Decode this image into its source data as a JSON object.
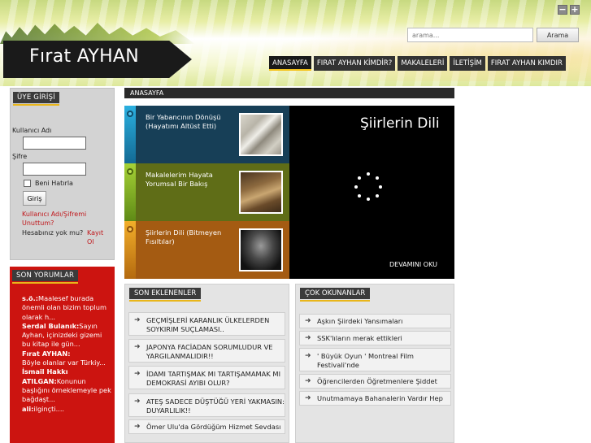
{
  "window_controls": {
    "minimize": "−",
    "maximize": "+"
  },
  "search": {
    "placeholder": "arama...",
    "button": "Arama"
  },
  "logo": {
    "text": "Fırat AYHAN"
  },
  "nav": [
    {
      "label": "ANASAYFA"
    },
    {
      "label": "FIRAT AYHAN KİMDİR?"
    },
    {
      "label": "MAKALELERİ"
    },
    {
      "label": "İLETİŞİM"
    },
    {
      "label": "FIRAT AYHAN KIMDIR"
    }
  ],
  "login": {
    "title": "ÜYE GİRİŞİ",
    "username_label": "Kullanıcı Adı",
    "password_label": "Şifre",
    "remember": "Beni Hatırla",
    "submit": "Giriş",
    "forgot": "Kullanıcı Adı/Şifremi Unuttum?",
    "no_account": "Hesabınız yok mu?",
    "register": "Kayıt Ol"
  },
  "comments": {
    "title": "SON YORUMLAR",
    "items": [
      {
        "author": "s.ö.:",
        "text": "Maalesef burada önemli olan bizim toplum olarak h..."
      },
      {
        "author": "Serdal Bulanık:",
        "text": "Sayın Ayhan, içinizdeki gizemi bu kitap ile gün..."
      },
      {
        "author": "Fırat AYHAN:",
        "text": "Böyle olanlar var Türkiy..."
      },
      {
        "author": "İsmail Hakkı ATILGAN:",
        "text": "Konunun başlığını örneklemeyle pek bağdaşt..."
      },
      {
        "author": "ali:",
        "text": "ilginçti...."
      }
    ]
  },
  "breadcrumb": "ANASAYFA",
  "featured": {
    "items": [
      {
        "title": "Bir Yabancının Dönüşü (Hayatımı Altüst Etti)",
        "color": "#173f57",
        "strip": "#1d93c4"
      },
      {
        "title": "Makalelerim Hayata Yorumsal Bir Bakış",
        "color": "#5f6d17",
        "strip": "#8ebf2a"
      },
      {
        "title": "Şiirlerin Dili (Bitmeyen Fısıltılar)",
        "color": "#a45b12",
        "strip": "#e79a1d"
      }
    ],
    "headline": "Şiirlerin Dili",
    "more": "DEVAMINI OKU"
  },
  "recent": {
    "title": "SON EKLENENLER",
    "items": [
      "GEÇMİŞLERİ KARANLIK ÜLKELERDEN SOYKIRIM SUÇLAMASI..",
      "JAPONYA FACİADAN SORUMLUDUR VE YARGILANMALIDIR!!",
      "İDAMI TARTIŞMAK MI TARTIŞAMAMAK MI DEMOKRASİ AYIBI OLUR?",
      "ATEŞ SADECE DÜŞTÜĞÜ YERİ YAKMASIN: DUYARLILIK!!",
      "Ömer Ulu'da Gördüğüm Hizmet Sevdası"
    ]
  },
  "popular": {
    "title": "ÇOK OKUNANLAR",
    "items": [
      "Aşkın Şiirdeki Yansımaları",
      "SSK'lıların merak ettikleri",
      "' Büyük Oyun ' Montreal Film Festivali'nde",
      "Öğrencilerden Öğretmenlere Şiddet",
      "Unutmamaya Bahanalerin Vardır Hep"
    ]
  }
}
